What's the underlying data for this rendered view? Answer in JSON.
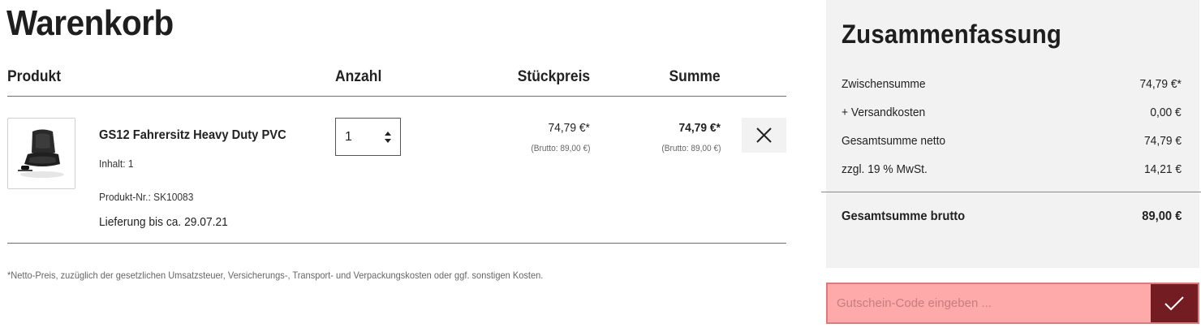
{
  "cart": {
    "title": "Warenkorb",
    "columns": {
      "product": "Produkt",
      "quantity": "Anzahl",
      "unit_price": "Stückpreis",
      "sum": "Summe"
    },
    "items": [
      {
        "image_icon": "seat-thumbnail-icon",
        "name": "GS12 Fahrersitz Heavy Duty PVC",
        "content": "Inhalt: 1",
        "sku": "Produkt-Nr.: SK10083",
        "delivery": "Lieferung bis ca. 29.07.21",
        "quantity": "1",
        "unit_price": "74,79 €*",
        "unit_price_brutto": "(Brutto: 89,00 €)",
        "sum": "74,79 €*",
        "sum_brutto": "(Brutto: 89,00 €)",
        "remove_icon": "close-icon"
      }
    ],
    "footnote": "*Netto-Preis, zuzüglich der gesetzlichen Umsatzsteuer, Versicherungs-, Transport- und Verpackungskosten oder ggf. sonstigen Kosten."
  },
  "summary": {
    "title": "Zusammenfassung",
    "lines": [
      {
        "label": "Zwischensumme",
        "value": "74,79 €*"
      },
      {
        "label": "+ Versandkosten",
        "value": "0,00 €"
      },
      {
        "label": "Gesamtsumme netto",
        "value": "74,79 €"
      },
      {
        "label": "zzgl. 19 % MwSt.",
        "value": "14,21 €"
      }
    ],
    "total_label": "Gesamtsumme brutto",
    "total_value": "89,00 €"
  },
  "voucher": {
    "placeholder": "Gutschein-Code eingeben ...",
    "submit_icon": "checkmark-icon"
  },
  "colors": {
    "summary_bg": "#f2f2f2",
    "voucher_bg": "#ffaaaa",
    "voucher_button": "#731d22",
    "divider": "#6f6f6f"
  }
}
